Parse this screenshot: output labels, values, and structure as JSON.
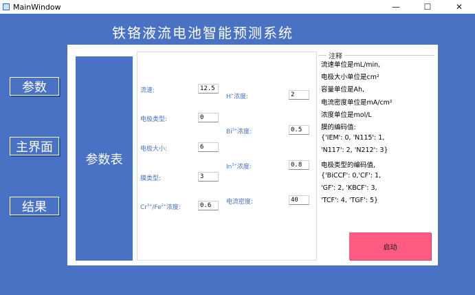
{
  "window": {
    "title": "MainWindow",
    "minimize": "—",
    "maximize": "☐",
    "close": "✕"
  },
  "header": {
    "title": "铁铬液流电池智能预测系统"
  },
  "nav": {
    "params": "参数",
    "main": "主界面",
    "results": "结果"
  },
  "side_label": "参数表",
  "form": {
    "flow_speed": {
      "label": "流速:",
      "value": "12.5"
    },
    "electrode_type": {
      "label": "电极类型:",
      "value": "0"
    },
    "electrode_size": {
      "label": "电极大小:",
      "value": "6"
    },
    "membrane_type": {
      "label": "膜类型:",
      "value": "3"
    },
    "cr_fe": {
      "label_a": "Cr",
      "sup_a": "3+",
      "label_b": "/Fe",
      "sup_b": "2+",
      "label_c": "浓度:",
      "value": "0.6"
    },
    "h": {
      "label_a": "H",
      "sup_a": "+",
      "label_c": "浓度:",
      "value": "2"
    },
    "bi": {
      "label_a": "Bi",
      "sup_a": "3+",
      "label_c": "浓度:",
      "value": "0.5"
    },
    "in": {
      "label_a": "In",
      "sup_a": "3+",
      "label_c": "浓度:",
      "value": "0.8"
    },
    "current_density": {
      "label": "电流密度:",
      "value": "40"
    }
  },
  "notes": {
    "title": "注释",
    "lines": [
      "流速单位是mL/min,",
      "电极大小单位是cm²",
      "容量单位是Ah,",
      "电流密度单位是mA/cm²",
      "浓度单位是mol/L",
      "膜的编码值:",
      "{'IEM': 0, 'N115': 1,",
      "'N117': 2, 'N212': 3}",
      "电极类型的编码值,",
      "{'BiCCF': 0,'CF': 1,",
      "'GF': 2, 'KBCF': 3,",
      "'TCF': 4, 'TGF': 5}"
    ]
  },
  "start_button": "启动",
  "colors": {
    "background": "#4a72c4",
    "start": "#ff5a82"
  }
}
